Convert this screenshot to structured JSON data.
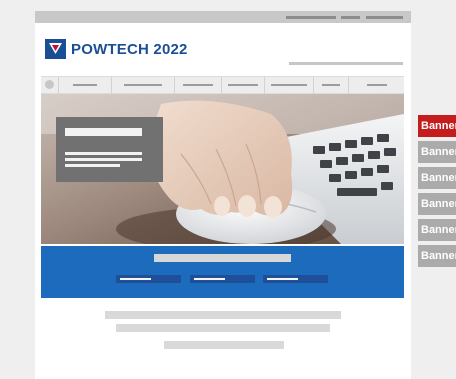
{
  "brand": {
    "logo_text": "POWTECH 2022",
    "logo_color": "#1b4f93",
    "logo_accent": "#c8102e"
  },
  "colors": {
    "hero_band": "#1c6bbd",
    "banner_active": "#c41d1e",
    "banner_inactive": "#ababab",
    "placeholder_gray": "#c8c8c8"
  },
  "nav": {
    "home_icon": "home-icon"
  },
  "side_banners": [
    {
      "label": "Banner",
      "active": true
    },
    {
      "label": "Banner",
      "active": false
    },
    {
      "label": "Banner",
      "active": false
    },
    {
      "label": "Banner",
      "active": false
    },
    {
      "label": "Banner",
      "active": false
    },
    {
      "label": "Banner",
      "active": false
    }
  ]
}
